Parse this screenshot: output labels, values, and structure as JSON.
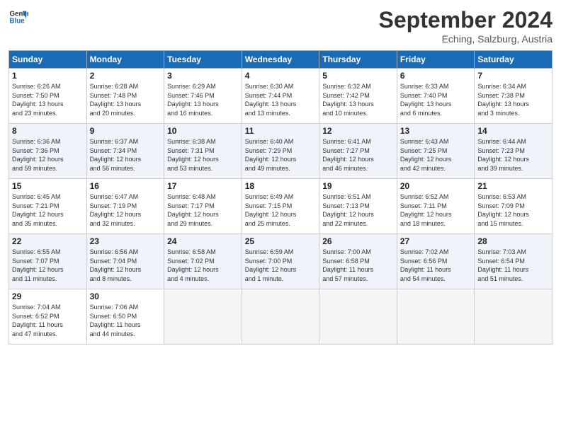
{
  "header": {
    "logo_line1": "General",
    "logo_line2": "Blue",
    "month_year": "September 2024",
    "location": "Eching, Salzburg, Austria"
  },
  "weekdays": [
    "Sunday",
    "Monday",
    "Tuesday",
    "Wednesday",
    "Thursday",
    "Friday",
    "Saturday"
  ],
  "weeks": [
    [
      {
        "day": "1",
        "info": "Sunrise: 6:26 AM\nSunset: 7:50 PM\nDaylight: 13 hours\nand 23 minutes."
      },
      {
        "day": "2",
        "info": "Sunrise: 6:28 AM\nSunset: 7:48 PM\nDaylight: 13 hours\nand 20 minutes."
      },
      {
        "day": "3",
        "info": "Sunrise: 6:29 AM\nSunset: 7:46 PM\nDaylight: 13 hours\nand 16 minutes."
      },
      {
        "day": "4",
        "info": "Sunrise: 6:30 AM\nSunset: 7:44 PM\nDaylight: 13 hours\nand 13 minutes."
      },
      {
        "day": "5",
        "info": "Sunrise: 6:32 AM\nSunset: 7:42 PM\nDaylight: 13 hours\nand 10 minutes."
      },
      {
        "day": "6",
        "info": "Sunrise: 6:33 AM\nSunset: 7:40 PM\nDaylight: 13 hours\nand 6 minutes."
      },
      {
        "day": "7",
        "info": "Sunrise: 6:34 AM\nSunset: 7:38 PM\nDaylight: 13 hours\nand 3 minutes."
      }
    ],
    [
      {
        "day": "8",
        "info": "Sunrise: 6:36 AM\nSunset: 7:36 PM\nDaylight: 12 hours\nand 59 minutes."
      },
      {
        "day": "9",
        "info": "Sunrise: 6:37 AM\nSunset: 7:34 PM\nDaylight: 12 hours\nand 56 minutes."
      },
      {
        "day": "10",
        "info": "Sunrise: 6:38 AM\nSunset: 7:31 PM\nDaylight: 12 hours\nand 53 minutes."
      },
      {
        "day": "11",
        "info": "Sunrise: 6:40 AM\nSunset: 7:29 PM\nDaylight: 12 hours\nand 49 minutes."
      },
      {
        "day": "12",
        "info": "Sunrise: 6:41 AM\nSunset: 7:27 PM\nDaylight: 12 hours\nand 46 minutes."
      },
      {
        "day": "13",
        "info": "Sunrise: 6:43 AM\nSunset: 7:25 PM\nDaylight: 12 hours\nand 42 minutes."
      },
      {
        "day": "14",
        "info": "Sunrise: 6:44 AM\nSunset: 7:23 PM\nDaylight: 12 hours\nand 39 minutes."
      }
    ],
    [
      {
        "day": "15",
        "info": "Sunrise: 6:45 AM\nSunset: 7:21 PM\nDaylight: 12 hours\nand 35 minutes."
      },
      {
        "day": "16",
        "info": "Sunrise: 6:47 AM\nSunset: 7:19 PM\nDaylight: 12 hours\nand 32 minutes."
      },
      {
        "day": "17",
        "info": "Sunrise: 6:48 AM\nSunset: 7:17 PM\nDaylight: 12 hours\nand 29 minutes."
      },
      {
        "day": "18",
        "info": "Sunrise: 6:49 AM\nSunset: 7:15 PM\nDaylight: 12 hours\nand 25 minutes."
      },
      {
        "day": "19",
        "info": "Sunrise: 6:51 AM\nSunset: 7:13 PM\nDaylight: 12 hours\nand 22 minutes."
      },
      {
        "day": "20",
        "info": "Sunrise: 6:52 AM\nSunset: 7:11 PM\nDaylight: 12 hours\nand 18 minutes."
      },
      {
        "day": "21",
        "info": "Sunrise: 6:53 AM\nSunset: 7:09 PM\nDaylight: 12 hours\nand 15 minutes."
      }
    ],
    [
      {
        "day": "22",
        "info": "Sunrise: 6:55 AM\nSunset: 7:07 PM\nDaylight: 12 hours\nand 11 minutes."
      },
      {
        "day": "23",
        "info": "Sunrise: 6:56 AM\nSunset: 7:04 PM\nDaylight: 12 hours\nand 8 minutes."
      },
      {
        "day": "24",
        "info": "Sunrise: 6:58 AM\nSunset: 7:02 PM\nDaylight: 12 hours\nand 4 minutes."
      },
      {
        "day": "25",
        "info": "Sunrise: 6:59 AM\nSunset: 7:00 PM\nDaylight: 12 hours\nand 1 minute."
      },
      {
        "day": "26",
        "info": "Sunrise: 7:00 AM\nSunset: 6:58 PM\nDaylight: 11 hours\nand 57 minutes."
      },
      {
        "day": "27",
        "info": "Sunrise: 7:02 AM\nSunset: 6:56 PM\nDaylight: 11 hours\nand 54 minutes."
      },
      {
        "day": "28",
        "info": "Sunrise: 7:03 AM\nSunset: 6:54 PM\nDaylight: 11 hours\nand 51 minutes."
      }
    ],
    [
      {
        "day": "29",
        "info": "Sunrise: 7:04 AM\nSunset: 6:52 PM\nDaylight: 11 hours\nand 47 minutes."
      },
      {
        "day": "30",
        "info": "Sunrise: 7:06 AM\nSunset: 6:50 PM\nDaylight: 11 hours\nand 44 minutes."
      },
      {
        "day": "",
        "info": ""
      },
      {
        "day": "",
        "info": ""
      },
      {
        "day": "",
        "info": ""
      },
      {
        "day": "",
        "info": ""
      },
      {
        "day": "",
        "info": ""
      }
    ]
  ]
}
